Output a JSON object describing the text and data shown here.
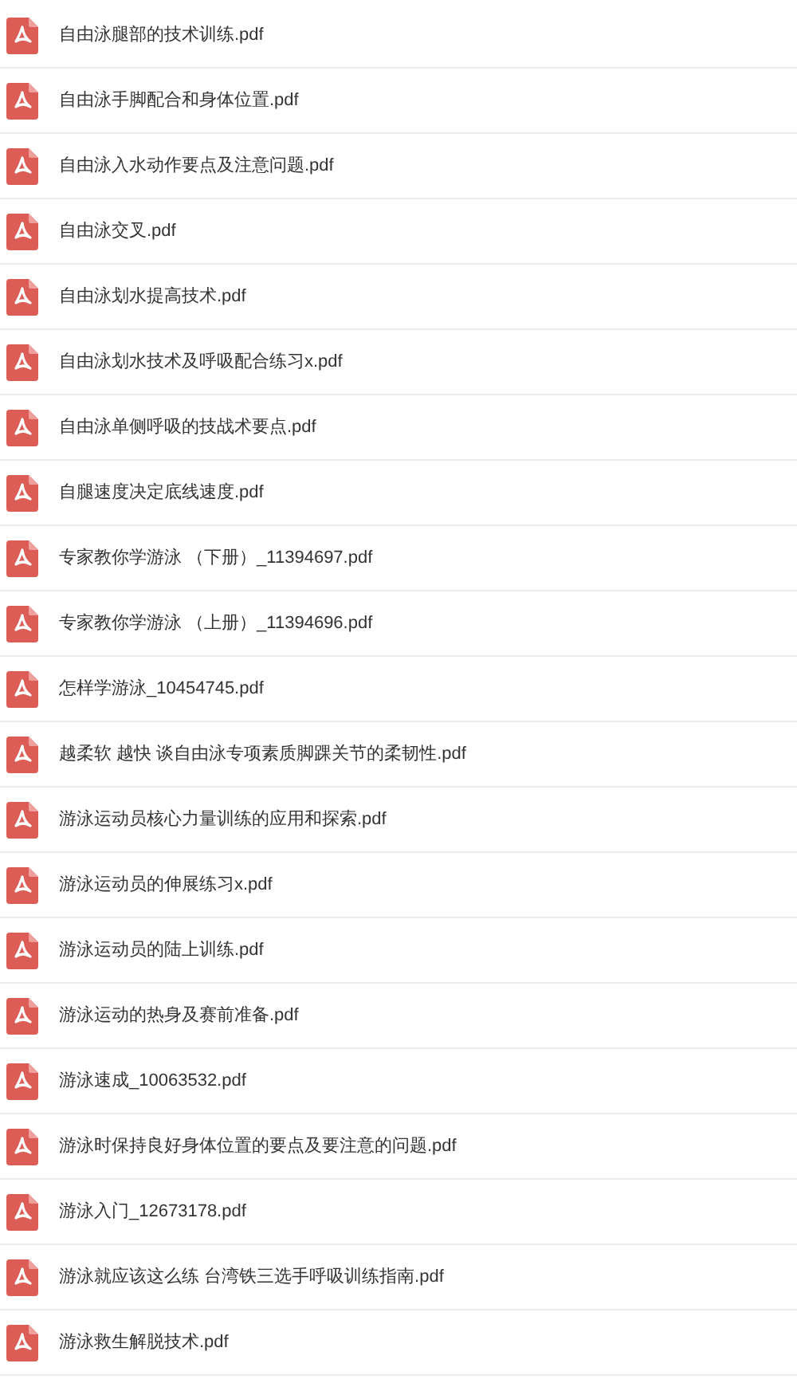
{
  "files": [
    {
      "name": "自由泳腿部的技术训练.pdf"
    },
    {
      "name": "自由泳手脚配合和身体位置.pdf"
    },
    {
      "name": "自由泳入水动作要点及注意问题.pdf"
    },
    {
      "name": "自由泳交叉.pdf"
    },
    {
      "name": "自由泳划水提高技术.pdf"
    },
    {
      "name": "自由泳划水技术及呼吸配合练习x.pdf"
    },
    {
      "name": "自由泳单侧呼吸的技战术要点.pdf"
    },
    {
      "name": "自腿速度决定底线速度.pdf"
    },
    {
      "name": "专家教你学游泳 （下册）_11394697.pdf"
    },
    {
      "name": "专家教你学游泳 （上册）_11394696.pdf"
    },
    {
      "name": "怎样学游泳_10454745.pdf"
    },
    {
      "name": "越柔软 越快 谈自由泳专项素质脚踝关节的柔韧性.pdf"
    },
    {
      "name": "游泳运动员核心力量训练的应用和探索.pdf"
    },
    {
      "name": "游泳运动员的伸展练习x.pdf"
    },
    {
      "name": "游泳运动员的陆上训练.pdf"
    },
    {
      "name": "游泳运动的热身及赛前准备.pdf"
    },
    {
      "name": "游泳速成_10063532.pdf"
    },
    {
      "name": "游泳时保持良好身体位置的要点及要注意的问题.pdf"
    },
    {
      "name": "游泳入门_12673178.pdf"
    },
    {
      "name": "游泳就应该这么练 台湾铁三选手呼吸训练指南.pdf"
    },
    {
      "name": "游泳救生解脱技术.pdf"
    }
  ]
}
